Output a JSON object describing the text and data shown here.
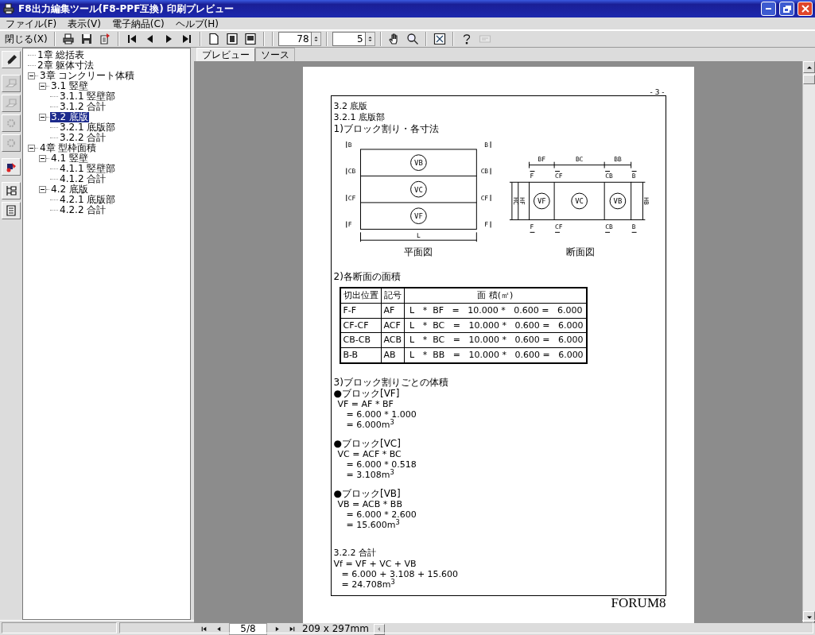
{
  "window": {
    "title": "F8出力編集ツール(F8-PPF互換) 印刷プレビュー"
  },
  "menu": [
    "ファイル(F)",
    "表示(V)",
    "電子納品(C)",
    "ヘルプ(H)"
  ],
  "toolbar": {
    "close_label": "閉じる(X)",
    "zoom": "78",
    "page": "5",
    "tools": [
      {
        "kind": "print",
        "disabled": false
      },
      {
        "kind": "save",
        "disabled": false
      },
      {
        "kind": "export",
        "disabled": false
      },
      {
        "kind": "first",
        "disabled": false
      },
      {
        "kind": "prev",
        "disabled": false
      },
      {
        "kind": "next",
        "disabled": false
      },
      {
        "kind": "last",
        "disabled": false
      },
      {
        "kind": "page",
        "disabled": false
      },
      {
        "kind": "page2",
        "disabled": false
      },
      {
        "kind": "page3",
        "disabled": false
      },
      {
        "kind": "hand",
        "disabled": false
      },
      {
        "kind": "zoom",
        "disabled": false
      },
      {
        "kind": "fit",
        "disabled": false
      },
      {
        "kind": "help",
        "disabled": false
      },
      {
        "kind": "card",
        "disabled": true
      }
    ]
  },
  "side_tools": [
    {
      "kind": "pen",
      "disabled": false
    },
    {
      "kind": "sheet",
      "disabled": true
    },
    {
      "kind": "sheet",
      "disabled": true
    },
    {
      "kind": "gear",
      "disabled": true
    },
    {
      "kind": "gear",
      "disabled": true
    },
    {
      "kind": "paint",
      "disabled": false
    },
    {
      "kind": "tree",
      "disabled": false
    },
    {
      "kind": "list",
      "disabled": false
    }
  ],
  "tree": [
    {
      "label": "1章 総括表",
      "selected": false
    },
    {
      "label": "2章 躯体寸法",
      "selected": false
    },
    {
      "label": "3章 コンクリート体積",
      "selected": false,
      "expanded": true,
      "children": [
        {
          "label": "3.1 竪壁",
          "selected": false,
          "expanded": true,
          "children": [
            {
              "label": "3.1.1 竪壁部",
              "selected": false
            },
            {
              "label": "3.1.2 合計",
              "selected": false
            }
          ]
        },
        {
          "label": "3.2 底版",
          "selected": true,
          "expanded": true,
          "children": [
            {
              "label": "3.2.1 底版部",
              "selected": false
            },
            {
              "label": "3.2.2 合計",
              "selected": false
            }
          ]
        }
      ]
    },
    {
      "label": "4章 型枠面積",
      "selected": false,
      "expanded": true,
      "children": [
        {
          "label": "4.1 竪壁",
          "selected": false,
          "expanded": true,
          "children": [
            {
              "label": "4.1.1 竪壁部",
              "selected": false
            },
            {
              "label": "4.1.2 合計",
              "selected": false
            }
          ]
        },
        {
          "label": "4.2 底版",
          "selected": false,
          "expanded": true,
          "children": [
            {
              "label": "4.2.1 底版部",
              "selected": false
            },
            {
              "label": "4.2.2 合計",
              "selected": false
            }
          ]
        }
      ]
    }
  ],
  "tabs": [
    {
      "label": "プレビュー",
      "selected": true
    },
    {
      "label": "ソース",
      "selected": false
    }
  ],
  "document": {
    "page_number": "- 3 -",
    "heading": "3.2 底版",
    "subheading": "3.2.1 底版部",
    "item1": "1)ブロック割り・各寸法",
    "plan": {
      "left_marks": [
        "B",
        "CB",
        "CF",
        "F"
      ],
      "right_marks": [
        "B",
        "CB",
        "CF",
        "F"
      ],
      "blocks": [
        "VB",
        "VC",
        "VF"
      ],
      "length": "L",
      "caption": "平面図"
    },
    "section": {
      "widths": [
        "BF",
        "BC",
        "BB"
      ],
      "top_marks": [
        "F",
        "CF",
        "CB",
        "B"
      ],
      "bottom_marks": [
        "F",
        "CF",
        "CB",
        "B"
      ],
      "left_heights": [
        "HC",
        "HF"
      ],
      "right_height": "HB",
      "blocks": [
        "VF",
        "VC",
        "VB"
      ],
      "caption": "断面図"
    },
    "item2": "2)各断面の面積",
    "table": {
      "columns": [
        "切出位置",
        "記号",
        "面 積(㎡)"
      ],
      "rows": [
        [
          "F-F",
          "AF",
          "L   *  BF   =   10.000 *   0.600 =   6.000"
        ],
        [
          "CF-CF",
          "ACF",
          "L   *  BC   =   10.000 *   0.600 =   6.000"
        ],
        [
          "CB-CB",
          "ACB",
          "L   *  BC   =   10.000 *   0.600 =   6.000"
        ],
        [
          "B-B",
          "AB",
          "L   *  BB   =   10.000 *   0.600 =   6.000"
        ]
      ]
    },
    "item3": "3)ブロック割りごとの体積",
    "blocks": [
      {
        "title": "●ブロック[VF]",
        "lines": [
          "VF = AF * BF",
          "= 6.000 * 1.000",
          "= 6.000m$^{3}$"
        ]
      },
      {
        "title": "●ブロック[VC]",
        "lines": [
          "VC = ACF * BC",
          "= 6.000 * 0.518",
          "= 3.108m$^{3}$"
        ]
      },
      {
        "title": "●ブロック[VB]",
        "lines": [
          "VB = ACB * BB",
          "= 6.000 * 2.600",
          "= 15.600m$^{3}$"
        ]
      }
    ],
    "total": {
      "heading": "3.2.2 合計",
      "lines": [
        "Vf = VF + VC + VB",
        "= 6.000 + 3.108 + 15.600",
        "= 24.708m$^{3}$"
      ]
    },
    "footer": "FORUM8"
  },
  "nav": {
    "page": "5/8",
    "paper": "209 x 297mm"
  }
}
